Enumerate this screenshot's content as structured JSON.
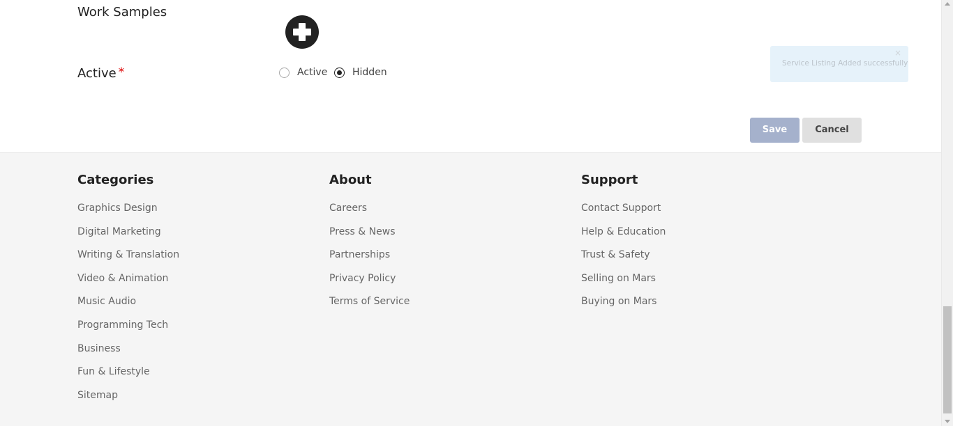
{
  "form": {
    "work_samples_label": "Work Samples",
    "active_label": "Active",
    "required_mark": "*",
    "radio_options": [
      {
        "label": "Active",
        "checked": false
      },
      {
        "label": "Hidden",
        "checked": true
      }
    ],
    "save_label": "Save",
    "cancel_label": "Cancel"
  },
  "toast": {
    "message": "Service Listing Added successfully",
    "close_glyph": "×"
  },
  "footer": {
    "columns": [
      {
        "title": "Categories",
        "links": [
          "Graphics Design",
          "Digital Marketing",
          "Writing & Translation",
          "Video & Animation",
          "Music Audio",
          "Programming Tech",
          "Business",
          "Fun & Lifestyle",
          "Sitemap"
        ]
      },
      {
        "title": "About",
        "links": [
          "Careers",
          "Press & News",
          "Partnerships",
          "Privacy Policy",
          "Terms of Service"
        ]
      },
      {
        "title": "Support",
        "links": [
          "Contact Support",
          "Help & Education",
          "Trust & Safety",
          "Selling on Mars",
          "Buying on Mars"
        ]
      }
    ]
  },
  "colors": {
    "save_button": "#a5b1cc",
    "cancel_button": "#e0e0e0",
    "toast_bg": "#e6f2fa",
    "required": "#dd0000",
    "footer_bg": "#f5f5f5"
  },
  "icons": {
    "add": "plus-circle-icon",
    "close": "close-icon"
  }
}
